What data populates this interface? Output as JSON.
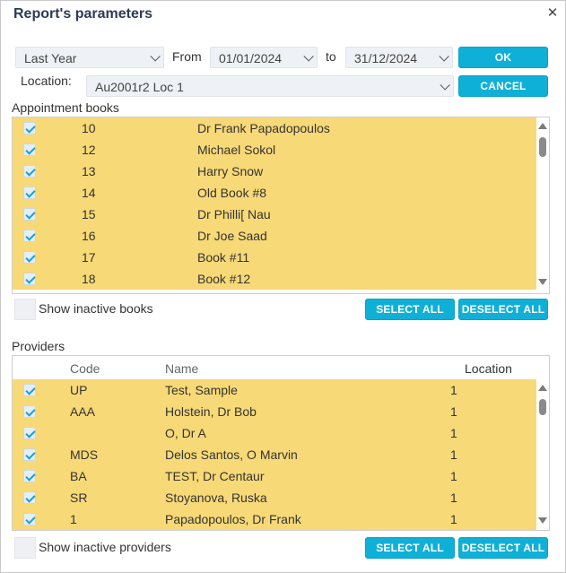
{
  "dialog": {
    "title": "Report's parameters",
    "close_icon": "close-icon"
  },
  "filters": {
    "period": "Last Year",
    "from_label": "From",
    "from_date": "01/01/2024",
    "to_label": "to",
    "to_date": "31/12/2024",
    "ok_label": "OK",
    "location_label": "Location:",
    "location": "Au2001r2 Loc 1",
    "cancel_label": "CANCEL"
  },
  "books": {
    "label": "Appointment books",
    "rows": [
      {
        "id": "10",
        "name": "Dr Frank Papadopoulos",
        "checked": true
      },
      {
        "id": "12",
        "name": "Michael Sokol",
        "checked": true
      },
      {
        "id": "13",
        "name": "Harry Snow",
        "checked": true
      },
      {
        "id": "14",
        "name": "Old Book #8",
        "checked": true
      },
      {
        "id": "15",
        "name": "Dr Philli[ Nau",
        "checked": true
      },
      {
        "id": "16",
        "name": "Dr Joe Saad",
        "checked": true
      },
      {
        "id": "17",
        "name": "Book #11",
        "checked": true
      },
      {
        "id": "18",
        "name": "Book #12",
        "checked": true
      }
    ],
    "show_inactive_label": "Show inactive books",
    "select_all_label": "SELECT ALL",
    "deselect_all_label": "DESELECT ALL"
  },
  "providers": {
    "label": "Providers",
    "headers": {
      "code": "Code",
      "name": "Name",
      "location": "Location"
    },
    "rows": [
      {
        "code": "UP",
        "name": "Test,  Sample",
        "location": "1",
        "checked": true
      },
      {
        "code": "AAA",
        "name": "Holstein, Dr Bob",
        "location": "1",
        "checked": true
      },
      {
        "code": "",
        "name": "O, Dr A",
        "location": "1",
        "checked": true
      },
      {
        "code": "MDS",
        "name": "Delos Santos, O Marvin",
        "location": "1",
        "checked": true
      },
      {
        "code": "BA",
        "name": "TEST, Dr Centaur",
        "location": "1",
        "checked": true
      },
      {
        "code": "SR",
        "name": "Stoyanova,  Ruska",
        "location": "1",
        "checked": true
      },
      {
        "code": "1",
        "name": "Papadopoulos, Dr Frank",
        "location": "1",
        "checked": true
      }
    ],
    "show_inactive_label": "Show inactive providers",
    "select_all_label": "SELECT ALL",
    "deselect_all_label": "DESELECT ALL"
  },
  "colors": {
    "accent": "#0fb0d7",
    "row_highlight": "#f8d977",
    "title": "#2b3a55"
  }
}
